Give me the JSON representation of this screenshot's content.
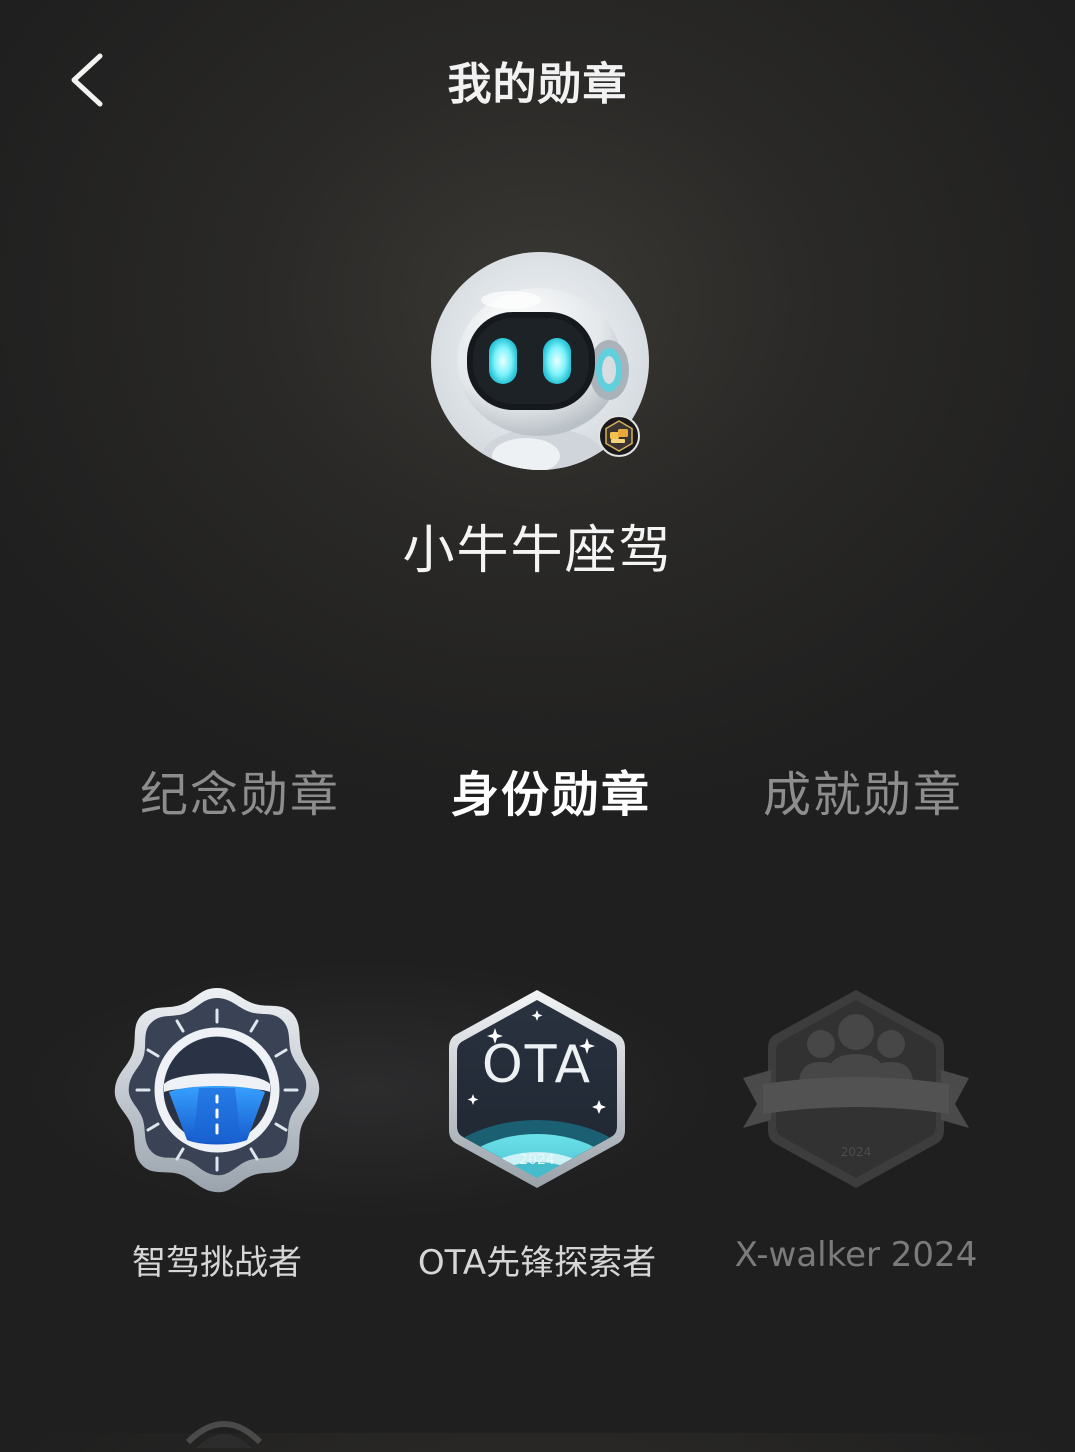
{
  "header": {
    "title": "我的勋章",
    "back_icon": "chevron-left-icon"
  },
  "profile": {
    "username": "小牛牛座驾",
    "avatar_icon": "robot-avatar-icon",
    "level_badge_icon": "level-badge-icon"
  },
  "tabs": [
    {
      "label": "纪念勋章",
      "active": false
    },
    {
      "label": "身份勋章",
      "active": true
    },
    {
      "label": "成就勋章",
      "active": false
    }
  ],
  "badges": [
    {
      "label": "智驾挑战者",
      "icon": "steering-wheel-badge-icon",
      "locked": false
    },
    {
      "label": "OTA先锋探索者",
      "icon": "ota-badge-icon",
      "badge_text": "OTA",
      "year": "2024",
      "locked": false
    },
    {
      "label": "X-walker 2024",
      "icon": "x-walker-badge-icon",
      "year": "2024",
      "locked": true
    }
  ],
  "colors": {
    "background": "#1f1f1f",
    "active_tab": "#ffffff",
    "inactive_tab": "#8d8d8d",
    "badge_blue": "#1e7be0",
    "badge_teal": "#3fb7c6"
  }
}
